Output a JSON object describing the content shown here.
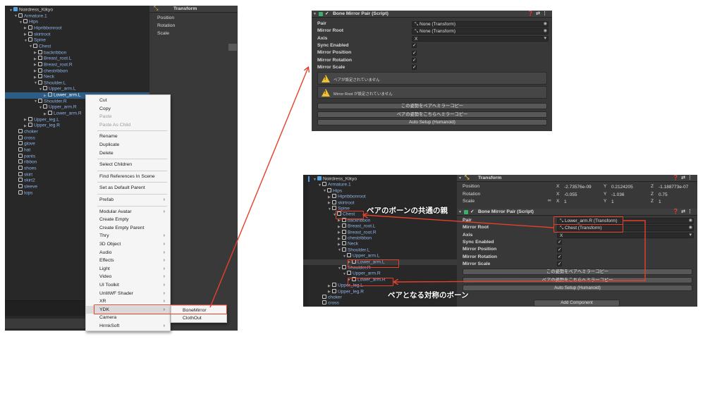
{
  "left_hierarchy": {
    "items": [
      {
        "label": "Noirdress_Kikyo",
        "depth": 0,
        "arrow": "▼",
        "root": true
      },
      {
        "label": "Armature.1",
        "depth": 1,
        "arrow": "▼"
      },
      {
        "label": "Hips",
        "depth": 2,
        "arrow": "▼"
      },
      {
        "label": "Hipribbonroot",
        "depth": 3,
        "arrow": "▶"
      },
      {
        "label": "skirtroot",
        "depth": 3,
        "arrow": "▶"
      },
      {
        "label": "Spine",
        "depth": 3,
        "arrow": "▼"
      },
      {
        "label": "Chest",
        "depth": 4,
        "arrow": "▼"
      },
      {
        "label": "backribbon",
        "depth": 5,
        "arrow": "▶"
      },
      {
        "label": "Breast_root.L",
        "depth": 5,
        "arrow": "▶"
      },
      {
        "label": "Breast_root.R",
        "depth": 5,
        "arrow": "▶"
      },
      {
        "label": "chestribbon",
        "depth": 5,
        "arrow": "▶"
      },
      {
        "label": "Neck",
        "depth": 5,
        "arrow": "▶"
      },
      {
        "label": "Shoulder.L",
        "depth": 5,
        "arrow": "▼"
      },
      {
        "label": "Upper_arm.L",
        "depth": 6,
        "arrow": "▼"
      },
      {
        "label": "Lower_arm.L",
        "depth": 7,
        "arrow": "▶",
        "selected": true
      },
      {
        "label": "Shoulder.R",
        "depth": 5,
        "arrow": "▼"
      },
      {
        "label": "Upper_arm.R",
        "depth": 6,
        "arrow": "▼"
      },
      {
        "label": "Lower_arm.R",
        "depth": 7,
        "arrow": "▶"
      },
      {
        "label": "Upper_leg.L",
        "depth": 3,
        "arrow": "▶"
      },
      {
        "label": "Upper_leg.R",
        "depth": 3,
        "arrow": "▶"
      },
      {
        "label": "choker",
        "depth": 1,
        "arrow": ""
      },
      {
        "label": "cross",
        "depth": 1,
        "arrow": ""
      },
      {
        "label": "glove",
        "depth": 1,
        "arrow": ""
      },
      {
        "label": "hat",
        "depth": 1,
        "arrow": ""
      },
      {
        "label": "pants",
        "depth": 1,
        "arrow": ""
      },
      {
        "label": "ribbon",
        "depth": 1,
        "arrow": ""
      },
      {
        "label": "shoes",
        "depth": 1,
        "arrow": ""
      },
      {
        "label": "skirt",
        "depth": 1,
        "arrow": ""
      },
      {
        "label": "skirt2",
        "depth": 1,
        "arrow": ""
      },
      {
        "label": "sleeve",
        "depth": 1,
        "arrow": ""
      },
      {
        "label": "tops",
        "depth": 1,
        "arrow": ""
      }
    ]
  },
  "left_transform": {
    "title": "Transform",
    "rows": [
      "Position",
      "Rotation",
      "Scale"
    ]
  },
  "context_menu": {
    "items": [
      {
        "label": "Cut"
      },
      {
        "label": "Copy"
      },
      {
        "label": "Paste",
        "disabled": true
      },
      {
        "label": "Paste As Child",
        "disabled": true
      },
      {
        "sep": true
      },
      {
        "label": "Rename"
      },
      {
        "label": "Duplicate"
      },
      {
        "label": "Delete"
      },
      {
        "sep": true
      },
      {
        "label": "Select Children"
      },
      {
        "sep": true
      },
      {
        "label": "Find References In Scene"
      },
      {
        "sep": true
      },
      {
        "label": "Set as Default Parent"
      },
      {
        "sep": true
      },
      {
        "label": "Prefab",
        "sub": true
      },
      {
        "sep": true
      },
      {
        "label": "Modular Avatar",
        "sub": true
      },
      {
        "label": "Create Empty"
      },
      {
        "label": "Create Empty Parent"
      },
      {
        "label": "Thry",
        "sub": true
      },
      {
        "label": "3D Object",
        "sub": true
      },
      {
        "label": "Audio",
        "sub": true
      },
      {
        "label": "Effects",
        "sub": true
      },
      {
        "label": "Light",
        "sub": true
      },
      {
        "label": "Video",
        "sub": true
      },
      {
        "label": "UI Toolkit",
        "sub": true
      },
      {
        "label": "UnlitWF Shader",
        "sub": true
      },
      {
        "label": "XR",
        "sub": true
      },
      {
        "label": "YDK",
        "sub": true,
        "highlight": true
      },
      {
        "label": "Camera"
      },
      {
        "label": "HrmkSoft",
        "sub": true
      }
    ],
    "submenu": [
      "BoneMirror",
      "ClothOut"
    ]
  },
  "top_inspector": {
    "title": "Bone Mirror Pair (Script)",
    "fields": [
      {
        "label": "Pair",
        "value": "None (Transform)",
        "type": "object"
      },
      {
        "label": "Mirror Root",
        "value": "None (Transform)",
        "type": "object"
      },
      {
        "label": "Axis",
        "value": "X",
        "type": "enum"
      },
      {
        "label": "Sync Enabled",
        "value": "✓",
        "type": "check"
      },
      {
        "label": "Mirror Position",
        "value": "✓",
        "type": "check"
      },
      {
        "label": "Mirror Rotation",
        "value": "✓",
        "type": "check"
      },
      {
        "label": "Mirror Scale",
        "value": "✓",
        "type": "check"
      }
    ],
    "warnings": [
      "ペアが設定されていません",
      "Mirror Root が設定されていません"
    ],
    "buttons": [
      "この姿勢をペアへミラーコピー",
      "ペアの姿勢をこちらへミラーコピー",
      "Auto Setup (Humanoid)"
    ]
  },
  "bottom_hierarchy": {
    "items": [
      {
        "label": "Noirdress_Kikyo",
        "depth": 0,
        "arrow": "▼",
        "root": true
      },
      {
        "label": "Armature.1",
        "depth": 1,
        "arrow": "▼"
      },
      {
        "label": "Hips",
        "depth": 2,
        "arrow": "▼"
      },
      {
        "label": "Hipribbonroot",
        "depth": 3,
        "arrow": "▶"
      },
      {
        "label": "skirtroot",
        "depth": 3,
        "arrow": "▶"
      },
      {
        "label": "Spine",
        "depth": 3,
        "arrow": "▼"
      },
      {
        "label": "Chest",
        "depth": 4,
        "arrow": "▼"
      },
      {
        "label": "backribbon",
        "depth": 5,
        "arrow": "▶"
      },
      {
        "label": "Breast_root.L",
        "depth": 5,
        "arrow": "▶"
      },
      {
        "label": "Breast_root.R",
        "depth": 5,
        "arrow": "▶"
      },
      {
        "label": "chestribbon",
        "depth": 5,
        "arrow": "▶"
      },
      {
        "label": "Neck",
        "depth": 5,
        "arrow": "▶"
      },
      {
        "label": "Shoulder.L",
        "depth": 5,
        "arrow": "▼"
      },
      {
        "label": "Upper_arm.L",
        "depth": 6,
        "arrow": "▼"
      },
      {
        "label": "Lower_arm.L",
        "depth": 7,
        "arrow": "▶",
        "selected2": true
      },
      {
        "label": "Shoulder.R",
        "depth": 5,
        "arrow": "▼"
      },
      {
        "label": "Upper_arm.R",
        "depth": 6,
        "arrow": "▼"
      },
      {
        "label": "Lower_arm.R",
        "depth": 7,
        "arrow": "▶"
      },
      {
        "label": "Upper_leg.L",
        "depth": 3,
        "arrow": "▶"
      },
      {
        "label": "Upper_leg.R",
        "depth": 3,
        "arrow": "▶"
      },
      {
        "label": "choker",
        "depth": 1,
        "arrow": ""
      },
      {
        "label": "cross",
        "depth": 1,
        "arrow": ""
      }
    ]
  },
  "bottom_transform": {
    "title": "Transform",
    "rows": [
      {
        "label": "Position",
        "x": "-2.73576e-09",
        "y": "0.2124205",
        "z": "-1.188773e-07"
      },
      {
        "label": "Rotation",
        "x": "-0.055",
        "y": "-1.036",
        "z": "0.75"
      },
      {
        "label": "Scale",
        "x": "1",
        "y": "1",
        "z": "1"
      }
    ]
  },
  "bottom_inspector": {
    "title": "Bone Mirror Pair (Script)",
    "fields": [
      {
        "label": "Pair",
        "value": "Lower_arm.R (Transform)",
        "type": "object"
      },
      {
        "label": "Mirror Root",
        "value": "Chest (Transform)",
        "type": "object"
      },
      {
        "label": "Axis",
        "value": "X",
        "type": "enum"
      },
      {
        "label": "Sync Enabled",
        "value": "✓",
        "type": "check"
      },
      {
        "label": "Mirror Position",
        "value": "✓",
        "type": "check"
      },
      {
        "label": "Mirror Rotation",
        "value": "✓",
        "type": "check"
      },
      {
        "label": "Mirror Scale",
        "value": "✓",
        "type": "check"
      }
    ],
    "buttons": [
      "この姿勢をペアへミラーコピー",
      "ペアの姿勢をこちらへミラーコピー",
      "Auto Setup (Humanoid)"
    ],
    "add_component": "Add Component"
  },
  "annotations": {
    "common_parent": "ペアのボーンの共通の親",
    "pair_bone": "ペアとなる対称のボーン"
  },
  "colors": {
    "accent_red": "#e5402a",
    "selection_blue": "#2c5d87",
    "warning_yellow": "#f2c12e"
  }
}
